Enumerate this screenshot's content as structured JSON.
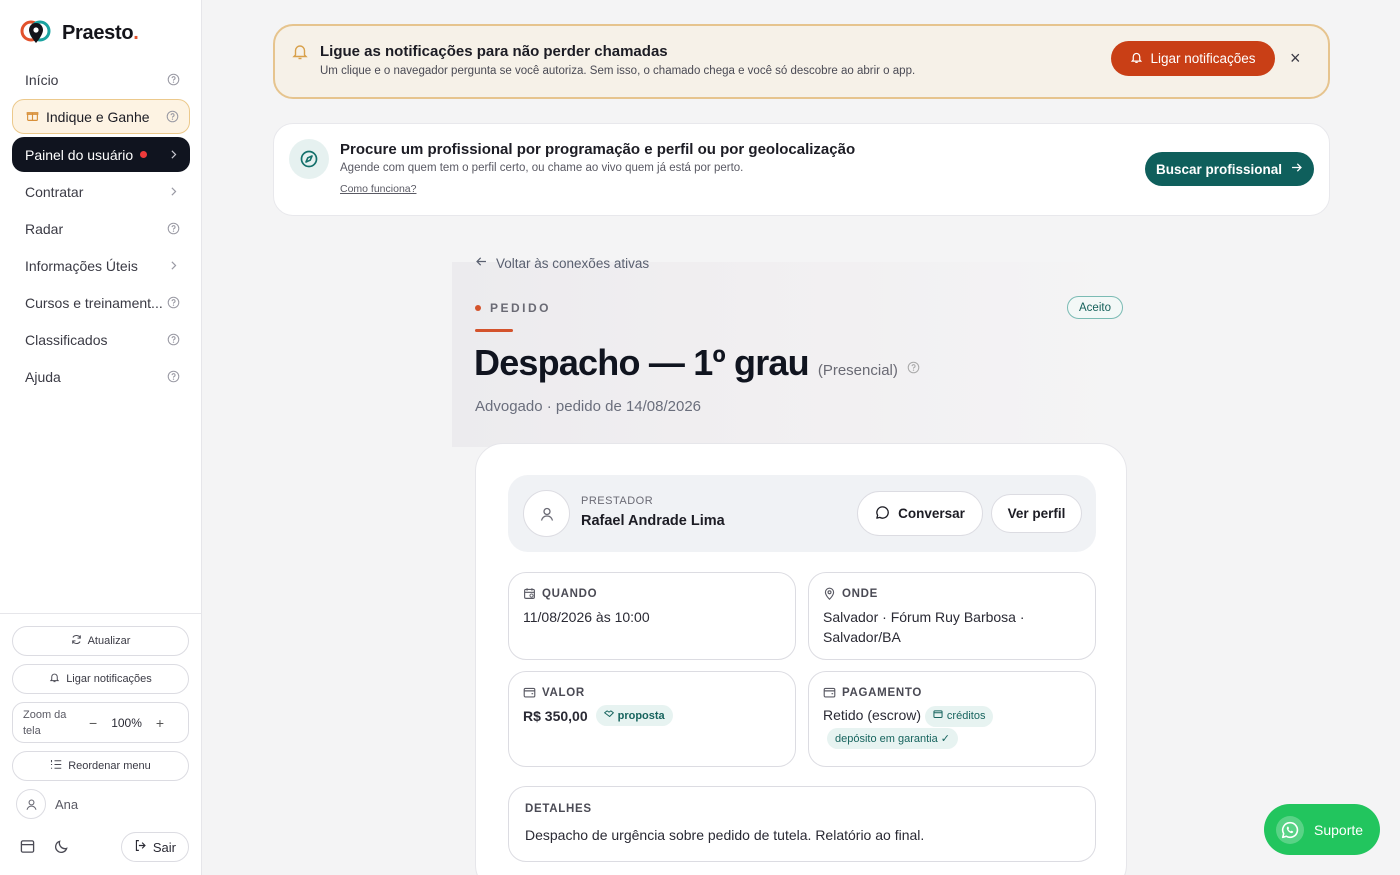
{
  "brand": {
    "name": "Praesto",
    "dot": "."
  },
  "sidebar": {
    "items": [
      {
        "label": "Início"
      },
      {
        "label": "Indique e Ganhe"
      },
      {
        "label": "Painel do usuário"
      },
      {
        "label": "Contratar"
      },
      {
        "label": "Radar"
      },
      {
        "label": "Informações Úteis"
      },
      {
        "label": "Cursos e treinament..."
      },
      {
        "label": "Classificados"
      },
      {
        "label": "Ajuda"
      }
    ],
    "refresh_label": "Atualizar",
    "notifications_label": "Ligar notificações",
    "zoom_label": "Zoom da tela",
    "zoom_value": "100%",
    "zoom_minus": "−",
    "zoom_plus": "+",
    "reorder_label": "Reordenar menu",
    "user_name": "Ana",
    "logout_label": "Sair"
  },
  "notification_banner": {
    "title": "Ligue as notificações para não perder chamadas",
    "text": "Um clique e o navegador pergunta se você autoriza. Sem isso, o chamado chega e você só descobre ao abrir o app.",
    "button": "Ligar notificações",
    "close": "×"
  },
  "search_banner": {
    "title": "Procure um profissional por programação e perfil ou por geolocalização",
    "text": "Agende com quem tem o perfil certo, ou chame ao vivo quem já está por perto.",
    "link": "Como funciona?",
    "button": "Buscar profissional"
  },
  "order": {
    "back_label": "Voltar às conexões ativas",
    "eyebrow": "PEDIDO",
    "status": "Aceito",
    "title": "Despacho — 1º grau",
    "mode": "(Presencial)",
    "subtitle": "Advogado · pedido de 14/08/2026",
    "provider": {
      "label": "PRESTADOR",
      "name": "Rafael Andrade Lima",
      "chat_button": "Conversar",
      "profile_button": "Ver perfil"
    },
    "when": {
      "label": "QUANDO",
      "value": "11/08/2026 às 10:00"
    },
    "where": {
      "label": "ONDE",
      "value_line1": "Salvador · Fórum Ruy Barbosa ·",
      "value_line2": "Salvador/BA"
    },
    "value": {
      "label": "VALOR",
      "amount": "R$ 350,00",
      "tag": "proposta"
    },
    "payment": {
      "label": "PAGAMENTO",
      "value": "Retido (escrow)",
      "tag1": "créditos",
      "tag2": "depósito em garantia ✓"
    },
    "details": {
      "label": "DETALHES",
      "text": "Despacho de urgência sobre pedido de tutela. Relatório ao final."
    }
  },
  "support": {
    "label": "Suporte"
  },
  "colors": {
    "accent": "#c93f16",
    "teal": "#0f5f5c",
    "dark": "#10141f",
    "whatsapp": "#22c55e"
  }
}
